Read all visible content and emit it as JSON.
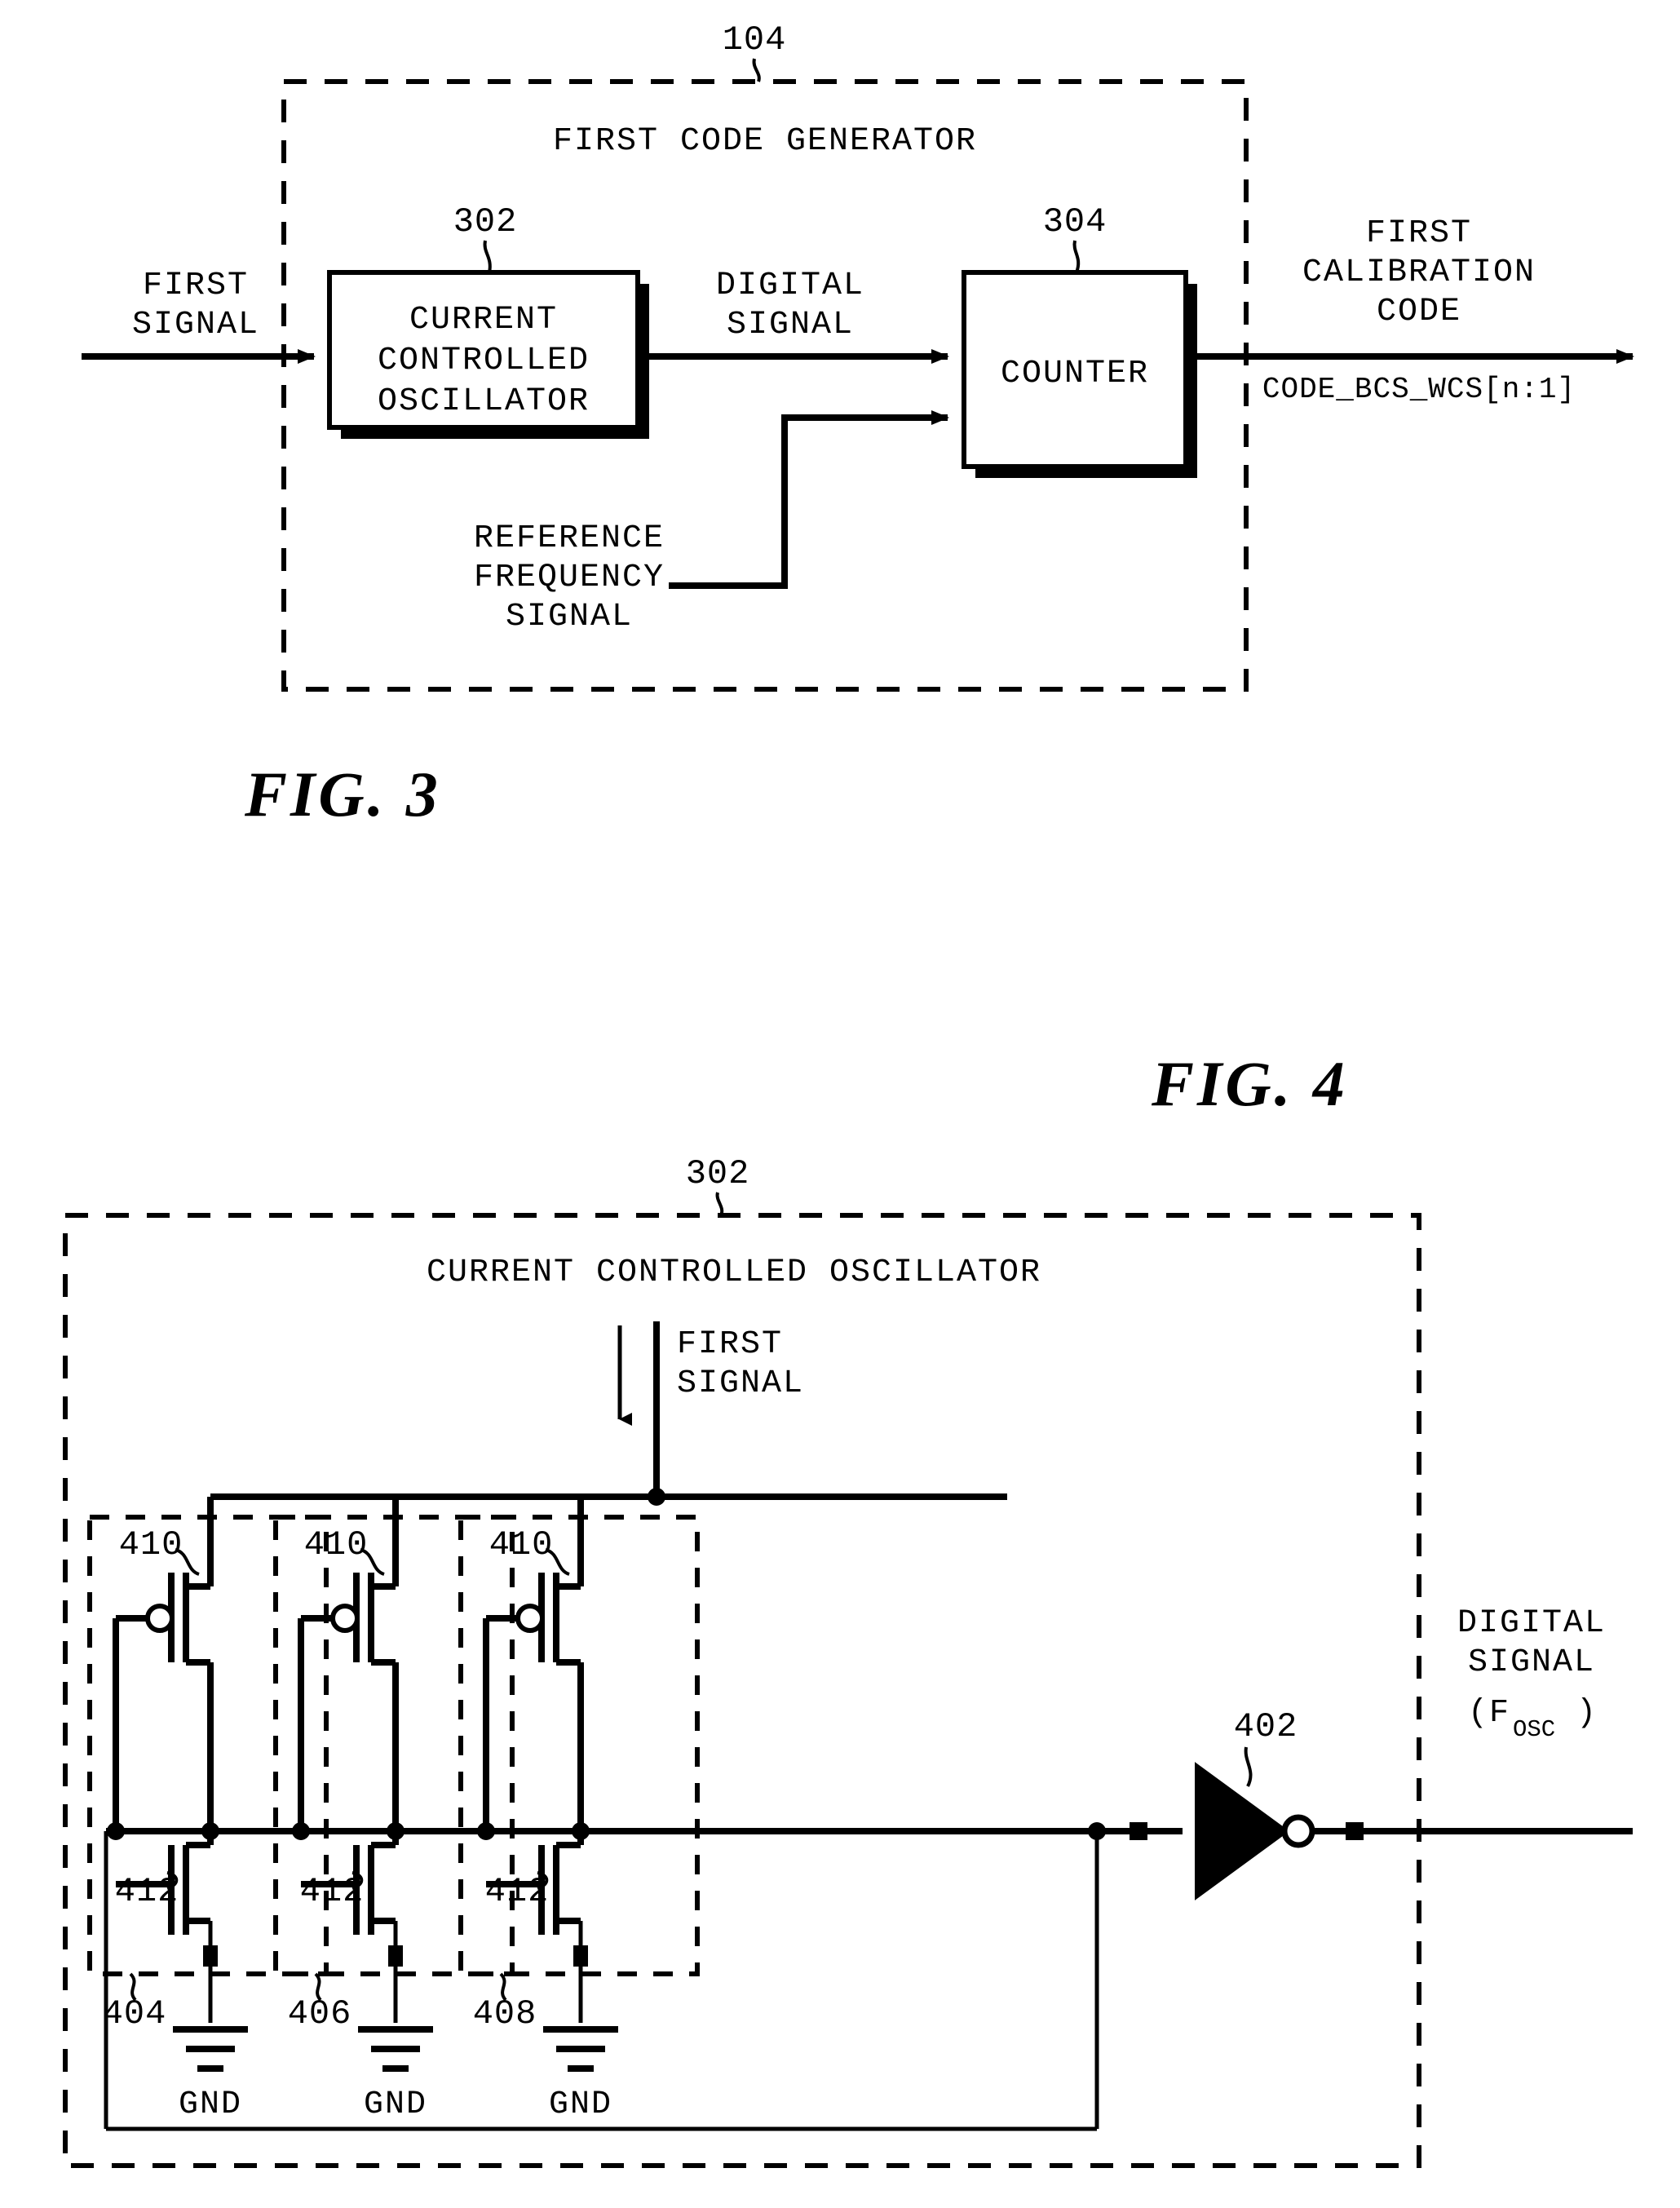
{
  "figure3": {
    "figure_title": "FIG. 3",
    "outer_ref": "104",
    "outer_title": "FIRST CODE GENERATOR",
    "input_label": "FIRST\nSIGNAL",
    "input_label_lines": [
      "FIRST",
      "SIGNAL"
    ],
    "blocks": [
      {
        "ref": "302",
        "label_lines": [
          "CURRENT",
          "CONTROLLED",
          "OSCILLATOR"
        ],
        "name": "current-controlled-oscillator"
      },
      {
        "ref": "304",
        "label_lines": [
          "COUNTER"
        ],
        "name": "counter"
      }
    ],
    "wire_labels": {
      "digital_signal_lines": [
        "DIGITAL",
        "SIGNAL"
      ],
      "reference_frequency_lines": [
        "REFERENCE",
        "FREQUENCY",
        "SIGNAL"
      ],
      "output_lines": [
        "FIRST",
        "CALIBRATION",
        "CODE"
      ],
      "output_bus": "CODE_BCS_WCS[n:1]"
    }
  },
  "figure4": {
    "figure_title": "FIG. 4",
    "outer_ref": "302",
    "outer_title": "CURRENT CONTROLLED OSCILLATOR",
    "input_label_lines": [
      "FIRST",
      "SIGNAL"
    ],
    "stages": [
      {
        "ref": "404",
        "pmos_ref": "410",
        "nmos_ref": "412",
        "gnd_label": "GND"
      },
      {
        "ref": "406",
        "pmos_ref": "410",
        "nmos_ref": "412",
        "gnd_label": "GND"
      },
      {
        "ref": "408",
        "pmos_ref": "410",
        "nmos_ref": "412",
        "gnd_label": "GND"
      }
    ],
    "inverter": {
      "ref": "402",
      "name": "output-inverter"
    },
    "output_label": {
      "lines": [
        "DIGITAL",
        "SIGNAL"
      ],
      "paren_open": "(F",
      "subscript": "OSC",
      "paren_close": ")"
    }
  },
  "colors": {
    "ink": "#000000",
    "paper": "#ffffff"
  }
}
